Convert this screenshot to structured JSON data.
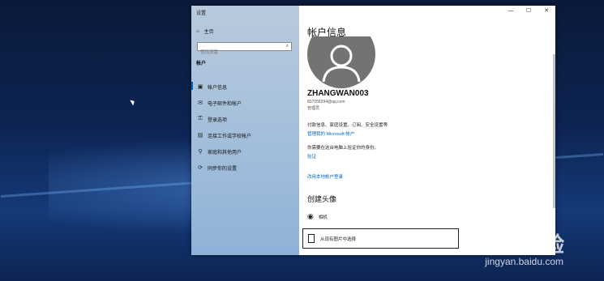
{
  "window": {
    "title": "设置",
    "controls": [
      "—",
      "☐",
      "✕"
    ]
  },
  "sidebar": {
    "home_label": "主页",
    "search_placeholder": "查找设置",
    "section_label": "帐户",
    "items": [
      {
        "label": "帐户信息",
        "icon": "person-card-icon",
        "selected": true
      },
      {
        "label": "电子邮件和帐户",
        "icon": "mail-icon",
        "selected": false
      },
      {
        "label": "登录选项",
        "icon": "key-icon",
        "selected": false
      },
      {
        "label": "连接工作或学校帐户",
        "icon": "briefcase-icon",
        "selected": false
      },
      {
        "label": "家庭和其他用户",
        "icon": "person-add-icon",
        "selected": false
      },
      {
        "label": "同步你的设置",
        "icon": "sync-icon",
        "selected": false
      }
    ]
  },
  "main": {
    "title": "帐户信息",
    "username": "ZHANGWAN003",
    "email": "837058394@qq.com",
    "role": "管理员",
    "billing_text": "付款信息、家庭设置、订阅、安全设置等",
    "manage_link": "管理我的 Microsoft 帐户",
    "verify_text": "你需要在这台电脑上验证你的身份。",
    "verify_link": "验证",
    "local_link": "改用本地帐户登录",
    "create_avatar_heading": "创建头像",
    "camera_label": "相机",
    "browse_label": "从现有图片中选择"
  },
  "watermark": {
    "text": "Bai 经验",
    "sub": "jingyan.baidu.com"
  },
  "colors": {
    "accent": "#0067c0",
    "avatar": "#737373"
  }
}
